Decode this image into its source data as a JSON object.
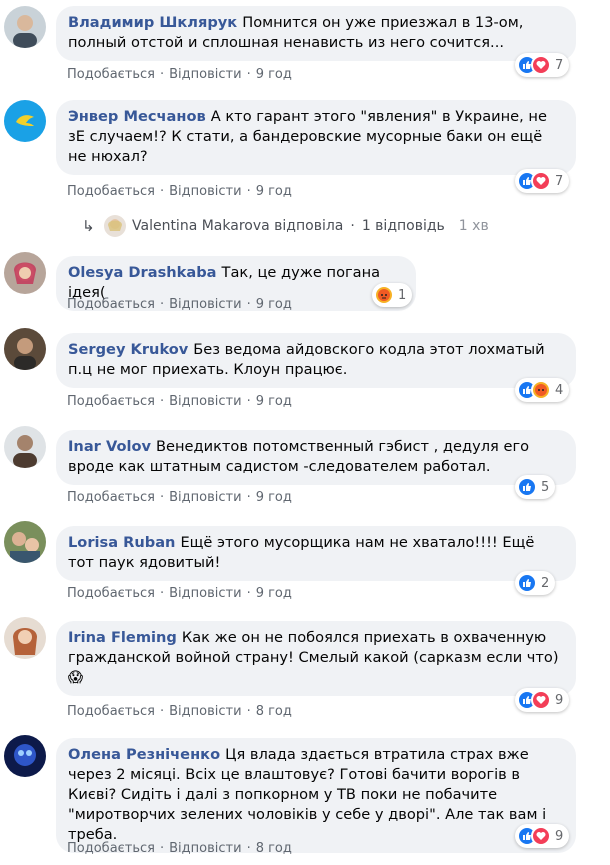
{
  "actions": {
    "like": "Подобається",
    "reply": "Відповісти",
    "sep": "·"
  },
  "comments": [
    {
      "author": "Владимир Шклярук",
      "text": "Помнится он уже приезжал в 13-ом, полный отстой и сплошная ненависть из него сочится...",
      "time": "9 год",
      "reactions": [
        "like",
        "love"
      ],
      "count": "7"
    },
    {
      "author": "Энвер Месчанов",
      "text": "А кто гарант этого \"явления\" в Украине, не зЕ случаем!? К стати, а бандеровские мусорные баки он ещё не нюхал?",
      "time": "9 год",
      "reactions": [
        "like",
        "love"
      ],
      "count": "7"
    },
    {
      "author": "Olesya Drashkaba",
      "text": "Так, це дуже погана ідея(",
      "time": "9 год",
      "reactions": [
        "angry"
      ],
      "count": "1"
    },
    {
      "author": "Sergey Krukov",
      "text": "Без ведома айдовского кодла этот лохматый п.ц не мог приехать. Клоун працює.",
      "time": "9 год",
      "reactions": [
        "like",
        "angry"
      ],
      "count": "4"
    },
    {
      "author": "Inar Volov",
      "text": "Венедиктов потомственный гэбист , дедуля его вроде как штатным садистом -следователем работал.",
      "time": "9 год",
      "reactions": [
        "like"
      ],
      "count": "5"
    },
    {
      "author": "Lorisa Ruban",
      "text": "Ещё этого мусорщика нам не хватало!!!! Ещё тот паук ядовитый!",
      "time": "9 год",
      "reactions": [
        "like"
      ],
      "count": "2"
    },
    {
      "author": "Irina Fleming",
      "text": "Как же он не побоялся приехать в охваченную гражданской войной страну! Смелый какой (сарказм если что)",
      "emoji": "😱",
      "time": "8 год",
      "reactions": [
        "like",
        "love"
      ],
      "count": "9"
    },
    {
      "author": "Олена Резніченко",
      "text": "Ця влада здається втратила страх вже через 2 місяці. Всіх це влаштовує? Готові бачити ворогів в Києві? Сидіть і далі з попкорном у ТВ поки не побачите \"миротворчих зелених чоловіків у себе у дворі\". Але так вам і треба.",
      "time": "8 год",
      "reactions": [
        "like",
        "love"
      ],
      "count": "9"
    }
  ],
  "reply": {
    "name": "Valentina Makarova",
    "verb": "відповіла",
    "sep": "·",
    "count_label": "1 відповідь",
    "time": "1 хв"
  },
  "colors": {
    "author": "#385898",
    "bubble": "#f0f2f5",
    "like": "#1877f2",
    "love": "#f33e58",
    "angry": "#f7b125"
  }
}
